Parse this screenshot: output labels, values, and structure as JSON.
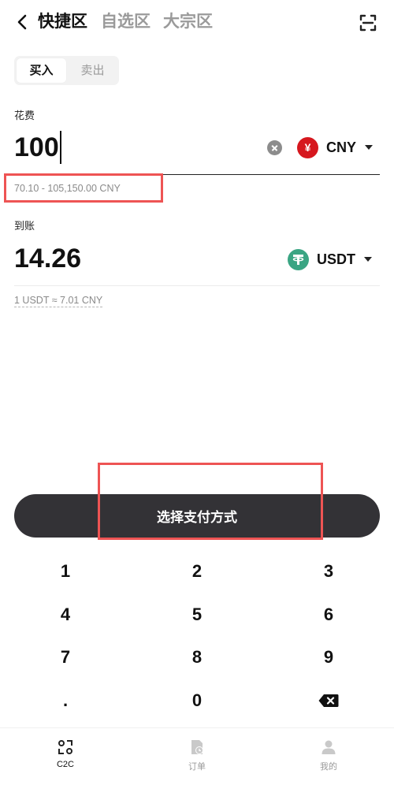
{
  "header": {
    "tabs": [
      {
        "label": "快捷区",
        "active": true
      },
      {
        "label": "自选区",
        "active": false
      },
      {
        "label": "大宗区",
        "active": false
      }
    ],
    "back_icon": "chevron-left-icon",
    "scan_icon": "scan-icon"
  },
  "trade_mode": {
    "buy_label": "买入",
    "sell_label": "卖出",
    "selected": "buy"
  },
  "spend": {
    "label": "花费",
    "value": "100",
    "currency": "CNY",
    "currency_symbol": "¥",
    "currency_color": "#d6171e",
    "range_hint": "70.10 - 105,150.00 CNY"
  },
  "receive": {
    "label": "到账",
    "value": "14.26",
    "currency": "USDT",
    "currency_symbol": "T",
    "currency_color": "#3aa583",
    "rate_hint": "1 USDT ≈ 7.01 CNY"
  },
  "primary_button": {
    "label": "选择支付方式"
  },
  "keypad": {
    "keys": [
      "1",
      "2",
      "3",
      "4",
      "5",
      "6",
      "7",
      "8",
      "9",
      ".",
      "0"
    ],
    "backspace_icon": "backspace-icon"
  },
  "bottom_nav": [
    {
      "label": "C2C",
      "icon": "c2c-icon",
      "active": true
    },
    {
      "label": "订单",
      "icon": "orders-icon",
      "active": false
    },
    {
      "label": "我的",
      "icon": "profile-icon",
      "active": false
    }
  ],
  "colors": {
    "accent_dark": "#333236",
    "highlight": "#ee5454",
    "muted_text": "#8a8a8a"
  }
}
